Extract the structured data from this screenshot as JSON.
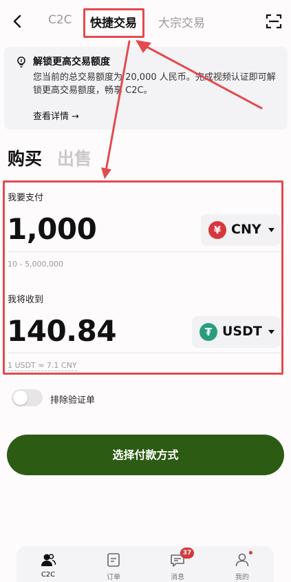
{
  "header": {
    "tabs": [
      {
        "label": "C2C"
      },
      {
        "label": "快捷交易",
        "active": true
      },
      {
        "label": "大宗交易"
      }
    ]
  },
  "notice": {
    "title": "解锁更高交易额度",
    "body": "您当前的总交易额度为 20,000 人民币。完成视频认证即可解锁更高交易额度，畅享 C2C。",
    "link": "查看详情 →"
  },
  "trade": {
    "buy_label": "购买",
    "sell_label": "出售",
    "pay_label": "我要支付",
    "pay_amount": "1,000",
    "pay_currency": "CNY",
    "pay_currency_symbol": "¥",
    "pay_range": "10 - 5,000,000",
    "receive_label": "我将收到",
    "receive_amount": "140.84",
    "receive_currency": "USDT",
    "receive_currency_symbol": "₮",
    "rate": "1 USDT ≈ 7.1 CNY"
  },
  "filter": {
    "exclude_verified_label": "排除验证单",
    "enabled": false
  },
  "cta": {
    "label": "选择付款方式"
  },
  "bottom_nav": {
    "items": [
      {
        "label": "C2C",
        "icon": "users-icon",
        "active": true
      },
      {
        "label": "订单",
        "icon": "document-icon"
      },
      {
        "label": "消息",
        "icon": "message-icon",
        "badge": "37"
      },
      {
        "label": "我的",
        "icon": "profile-icon",
        "dot": true
      }
    ]
  },
  "colors": {
    "accent_green": "#2c5b14",
    "highlight_red": "#e24a4f",
    "cny_coin": "#d9363e",
    "usdt_coin": "#2a9d7e",
    "badge_red": "#d23b3b"
  }
}
